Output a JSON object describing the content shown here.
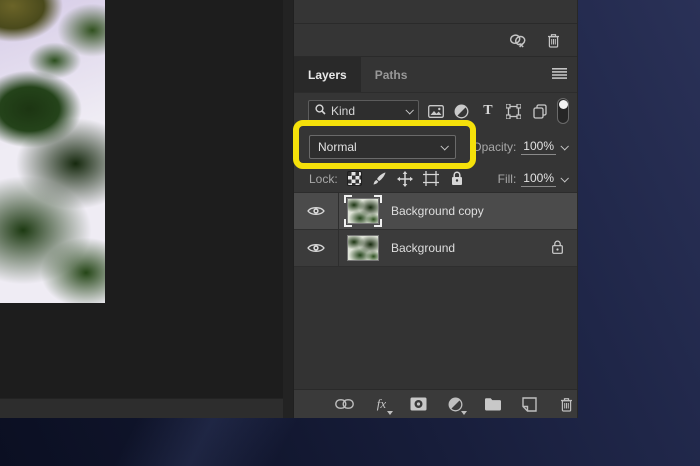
{
  "colors": {
    "highlight_yellow": "#f5e10a",
    "panel_bg": "#353535",
    "selected_row_bg": "#4b4b4b",
    "canvas_bg": "#1d1d1d",
    "desktop_navy": "#171d3a"
  },
  "top_section": {
    "icons": [
      "unlink-icon",
      "trash-icon"
    ]
  },
  "tabs": {
    "layers": "Layers",
    "paths": "Paths"
  },
  "filter_row": {
    "kind_label": "Kind",
    "icons": [
      "search-icon",
      "pixel-layer-filter-icon",
      "adjustment-layer-filter-icon",
      "type-layer-filter-icon",
      "shape-layer-filter-icon",
      "smart-object-filter-icon",
      "filter-toggle"
    ]
  },
  "blend_row": {
    "blend_mode": "Normal",
    "opacity_label": "Opacity:",
    "opacity_value": "100%"
  },
  "lock_row": {
    "lock_label": "Lock:",
    "icons": [
      "lock-transparent-icon",
      "lock-pixels-icon",
      "lock-position-icon",
      "lock-artboard-icon",
      "lock-all-icon"
    ],
    "fill_label": "Fill:",
    "fill_value": "100%"
  },
  "layers": [
    {
      "name": "Background copy",
      "selected": true,
      "locked": false
    },
    {
      "name": "Background",
      "selected": false,
      "locked": true
    }
  ],
  "footer": {
    "fx_label": "fx",
    "icons": [
      "link-layers-icon",
      "layer-style-icon",
      "layer-mask-icon",
      "adjustment-layer-icon",
      "new-group-icon",
      "new-layer-icon",
      "delete-layer-icon"
    ]
  }
}
